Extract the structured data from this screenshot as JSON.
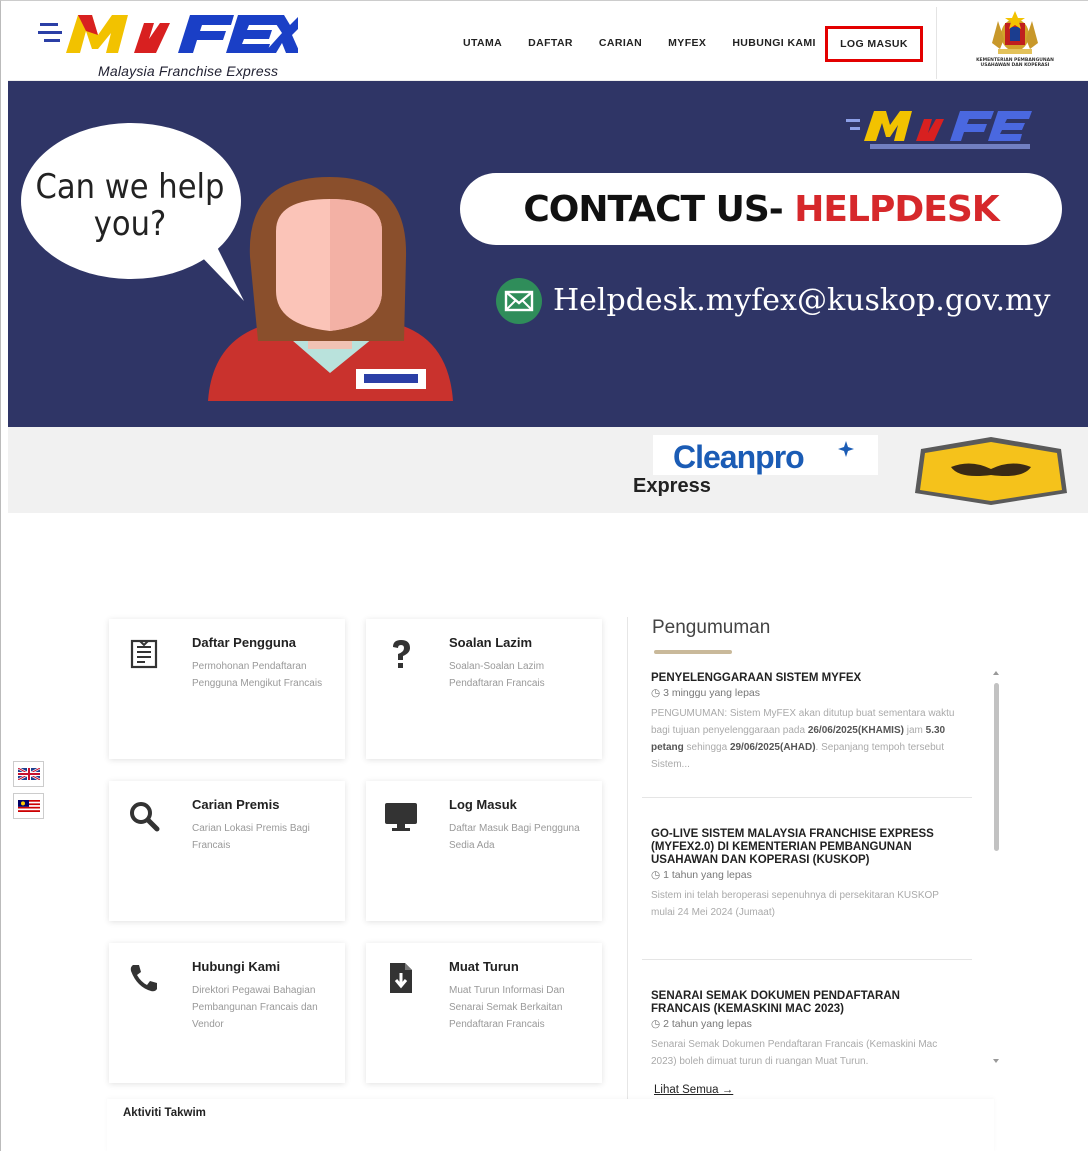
{
  "header": {
    "logo_tagline": "Malaysia Franchise Express",
    "nav": [
      "UTAMA",
      "DAFTAR",
      "CARIAN",
      "MYFEX",
      "HUBUNGI KAMI"
    ],
    "login": "LOG MASUK",
    "ministry_name": "KEMENTERIAN PEMBANGUNAN USAHAWAN DAN KOPERASI"
  },
  "banner": {
    "bubble": "Can we help you?",
    "pill_prefix": "CONTACT US-",
    "pill_highlight": "HELPDESK",
    "email": "Helpdesk.myfex@kuskop.gov.my"
  },
  "partners": {
    "cleanpro": "Cleanpro",
    "express": "Express"
  },
  "cards": [
    {
      "title": "Daftar Pengguna",
      "desc": "Permohonan Pendaftaran Pengguna Mengikut Francais",
      "icon": "register-form-icon"
    },
    {
      "title": "Soalan Lazim",
      "desc": "Soalan-Soalan Lazim Pendaftaran Francais",
      "icon": "question-icon"
    },
    {
      "title": "Carian Premis",
      "desc": "Carian Lokasi Premis Bagi Francais",
      "icon": "search-icon"
    },
    {
      "title": "Log Masuk",
      "desc": "Daftar Masuk Bagi Pengguna Sedia Ada",
      "icon": "monitor-icon"
    },
    {
      "title": "Hubungi Kami",
      "desc": "Direktori Pegawai Bahagian Pembangunan Francais dan Vendor",
      "icon": "phone-icon"
    },
    {
      "title": "Muat Turun",
      "desc": "Muat Turun Informasi Dan Senarai Semak Berkaitan Pendaftaran Francais",
      "icon": "download-file-icon"
    }
  ],
  "announcements": {
    "title": "Pengumuman",
    "items": [
      {
        "head": "PENYELENGGARAAN SISTEM MYFEX",
        "time": "3 minggu yang lepas",
        "body_a": "PENGUMUMAN: Sistem MyFEX akan ditutup buat sementara waktu bagi tujuan penyelenggaraan pada ",
        "body_b": "26/06/2025(KHAMIS)",
        "body_c": " jam ",
        "body_d": "5.30 petang",
        "body_e": " sehingga ",
        "body_f": "29/06/2025(AHAD)",
        "body_g": ". Sepanjang tempoh tersebut Sistem..."
      },
      {
        "head": "GO-LIVE SISTEM MALAYSIA FRANCHISE EXPRESS (MYFEX2.0) DI KEMENTERIAN PEMBANGUNAN USAHAWAN DAN KOPERASI (KUSKOP)",
        "time": "1 tahun yang lepas",
        "body": "Sistem ini telah beroperasi sepenuhnya di persekitaran KUSKOP mulai 24 Mei 2024 (Jumaat)"
      },
      {
        "head": "SENARAI SEMAK DOKUMEN PENDAFTARAN FRANCAIS (KEMASKINI MAC 2023)",
        "time": "2 tahun yang lepas",
        "body": "Senarai Semak Dokumen Pendaftaran Francais (Kemaskini Mac 2023) boleh dimuat turun di ruangan Muat Turun."
      }
    ],
    "see_all": "Lihat Semua →"
  },
  "calendar": {
    "title": "Aktiviti Takwim"
  },
  "colors": {
    "banner_bg": "#2f3566",
    "highlight_red": "#d6282b",
    "login_border": "#e30000"
  }
}
